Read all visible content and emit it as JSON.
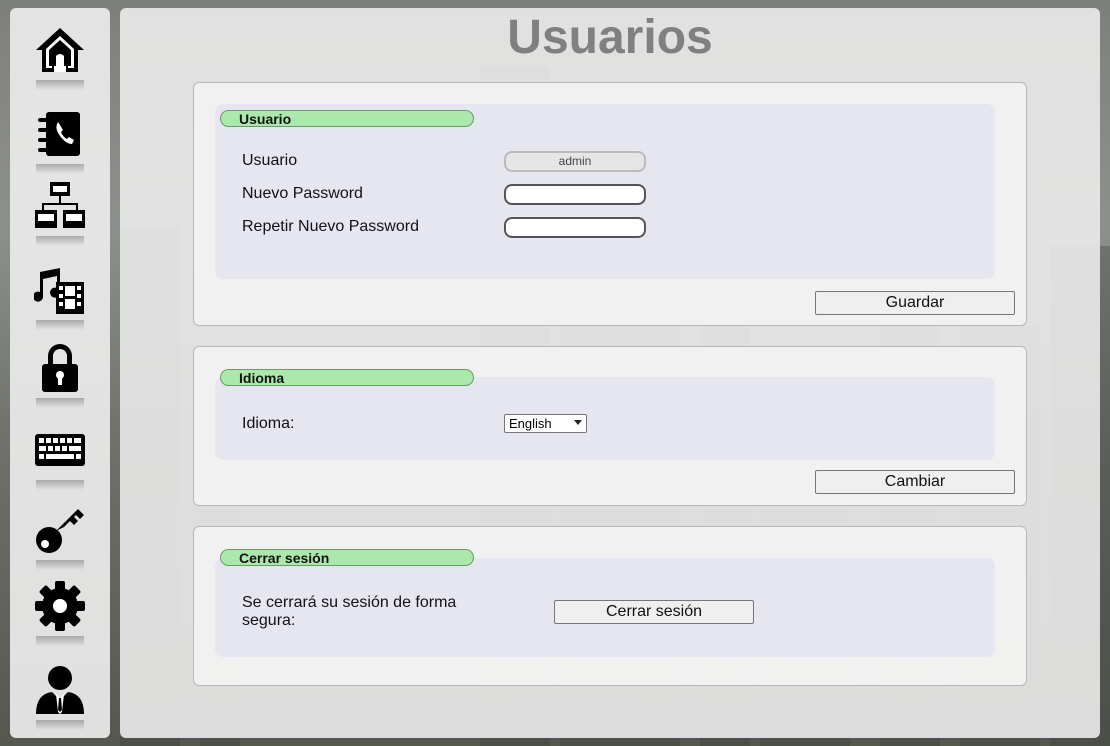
{
  "page": {
    "title": "Usuarios"
  },
  "sidebar": {
    "items": [
      {
        "icon": "home-icon"
      },
      {
        "icon": "phonebook-icon"
      },
      {
        "icon": "network-icon"
      },
      {
        "icon": "media-icon"
      },
      {
        "icon": "lock-icon"
      },
      {
        "icon": "keyboard-icon"
      },
      {
        "icon": "key-icon"
      },
      {
        "icon": "gear-icon"
      },
      {
        "icon": "user-icon"
      }
    ]
  },
  "usuario_section": {
    "legend": "Usuario",
    "username_label": "Usuario",
    "username_value": "admin",
    "new_password_label": "Nuevo Password",
    "new_password_value": "",
    "repeat_password_label": "Repetir Nuevo Password",
    "repeat_password_value": "",
    "save_button": "Guardar"
  },
  "idioma_section": {
    "legend": "Idioma",
    "language_label": "Idioma:",
    "language_selected": "English",
    "change_button": "Cambiar"
  },
  "logout_section": {
    "legend": "Cerrar sesión",
    "description": "Se cerrará su sesión de forma segura:",
    "logout_button": "Cerrar sesión"
  },
  "colors": {
    "legend_bg": "#abe8ab",
    "title": "#808080"
  }
}
